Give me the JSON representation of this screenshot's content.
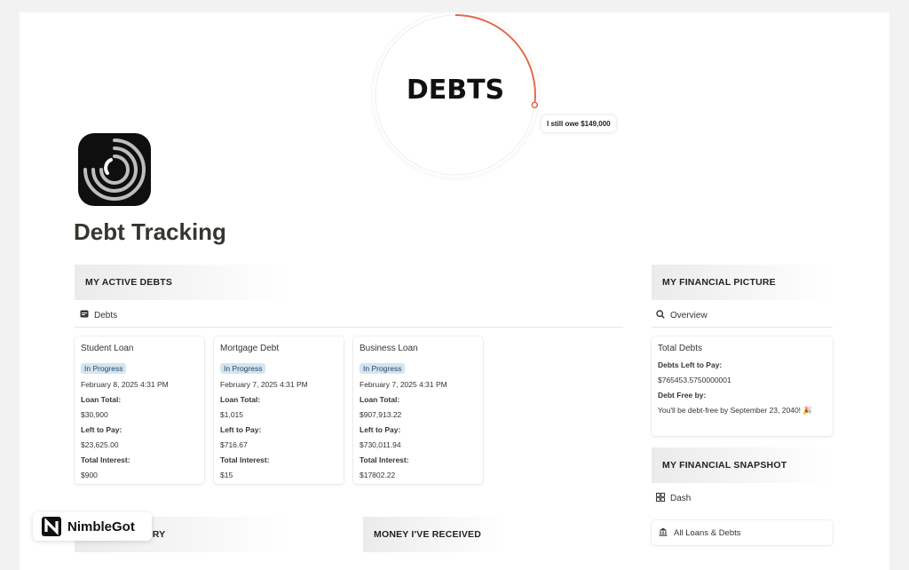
{
  "cover": {
    "title": "DEBTS",
    "owe_label": "I still owe $149,000",
    "progress_fraction": 0.27,
    "accent_color": "#e0694a"
  },
  "page": {
    "icon": "spiral-icon",
    "title": "Debt Tracking"
  },
  "active_debts": {
    "heading": "MY ACTIVE DEBTS",
    "view_label": "Debts",
    "view_icon": "table-icon",
    "cards": [
      {
        "title": "Student Loan",
        "status": "In Progress",
        "date": "February 8, 2025 4:31 PM",
        "loan_total_label": "Loan Total:",
        "loan_total": "$30,900",
        "left_label": "Left to Pay:",
        "left": "$23,625.00",
        "interest_label": "Total Interest:",
        "interest": "$900"
      },
      {
        "title": "Mortgage Debt",
        "status": "In Progress",
        "date": "February 7, 2025 4:31 PM",
        "loan_total_label": "Loan Total:",
        "loan_total": "$1,015",
        "left_label": "Left to Pay:",
        "left": "$716.67",
        "interest_label": "Total Interest:",
        "interest": "$15"
      },
      {
        "title": "Business Loan",
        "status": "In Progress",
        "date": "February 7, 2025 4:31 PM",
        "loan_total_label": "Loan Total:",
        "loan_total": "$907,913.22",
        "left_label": "Left to Pay:",
        "left": "$730,011.94",
        "interest_label": "Total Interest:",
        "interest": "$17802.22"
      }
    ]
  },
  "financial_picture": {
    "heading": "MY FINANCIAL PICTURE",
    "view_label": "Overview",
    "view_icon": "search-icon",
    "card": {
      "title": "Total Debts",
      "left_label": "Debts Left to Pay:",
      "left": "$765453.5750000001",
      "free_label": "Debt Free by:",
      "free_text": "You'll be debt-free by September 23, 2040! 🎉"
    }
  },
  "financial_snapshot": {
    "heading": "MY FINANCIAL SNAPSHOT",
    "view_label": "Dash",
    "view_icon": "grid-icon",
    "link_label": "All Loans & Debts",
    "link_icon": "bank-icon"
  },
  "bottom_sections": {
    "history_heading": "E DEBT HISTORY",
    "received_heading": "MONEY I'VE RECEIVED"
  },
  "watermark": {
    "brand": "NimbleGot"
  }
}
